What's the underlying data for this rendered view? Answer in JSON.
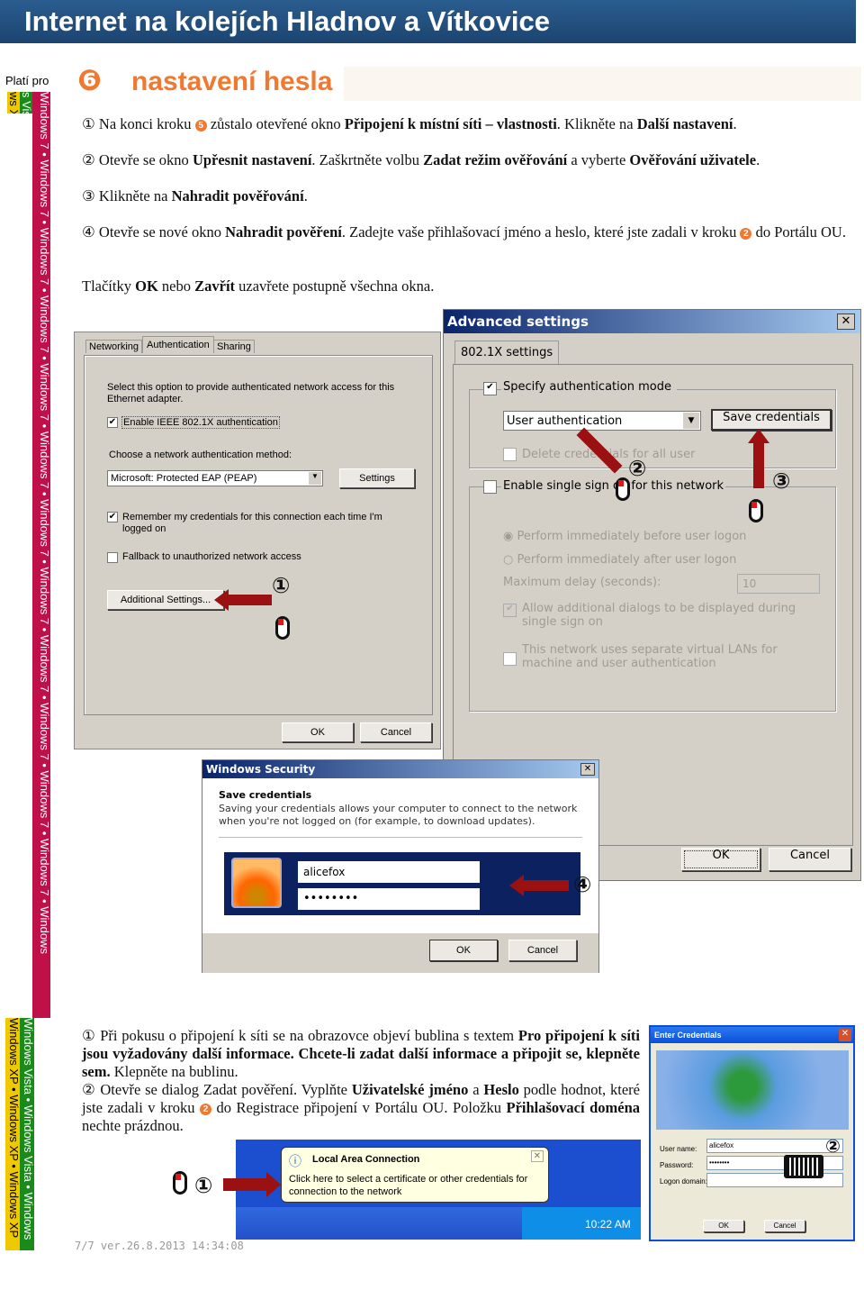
{
  "header": {
    "title": "Internet na kolejích Hladnov a Vítkovice"
  },
  "sidebar": {
    "applies_label": "Platí pro",
    "win7": "Windows 7 • Windows 7 • Windows 7 • Windows 7 • Windows 7 • Windows 7 • Windows 7 • Windows 7 • Windows 7 • Windows 7 • Windows 7 • Windows 7 • Windows",
    "vista": "Windows Vista • Windows Vista • Windows",
    "xp": "Windows XP • Windows XP • Windows XP",
    "top_yellow": "ws XP",
    "top_green": "s Vista"
  },
  "section": {
    "number": "❻",
    "title": "nastavení hesla"
  },
  "steps": [
    {
      "html": "① Na konci kroku <span class='num'>5</span> zůstalo otevřené okno <b>Připojení k místní síti – vlastnosti</b>. Klikněte na <b>Další nastavení</b>."
    },
    {
      "html": "② Otevře se okno <b>Upřesnit nastavení</b>. Zaškrtněte volbu <b>Zadat režim ověřování</b> a vyberte <b>Ověřování uživatele</b>."
    },
    {
      "html": "③ Klikněte na <b>Nahradit pověřování</b>."
    },
    {
      "html": "④ Otevře se nové okno <b>Nahradit pověření</b>. Zadejte vaše přihlašovací jméno a heslo, které jste zadali v kroku <span class='num'>2</span> do Portálu OU."
    },
    {
      "html": "Tlačítky <b>OK</b> nebo <b>Zavřít</b> uzavřete postupně všechna okna."
    }
  ],
  "properties_dialog": {
    "tabs": [
      "Networking",
      "Authentication",
      "Sharing"
    ],
    "desc": "Select this option to provide authenticated network access for this Ethernet adapter.",
    "enable_8021x": "Enable IEEE 802.1X authentication",
    "choose_method": "Choose a network authentication method:",
    "method_value": "Microsoft: Protected EAP (PEAP)",
    "settings": "Settings",
    "remember": "Remember my credentials for this connection each time I'm logged on",
    "fallback": "Fallback to unauthorized network access",
    "additional": "Additional Settings...",
    "ok": "OK",
    "cancel": "Cancel",
    "remember_checked": true,
    "enable_checked": true,
    "fallback_checked": false
  },
  "advanced_dialog": {
    "title": "Advanced settings",
    "tab": "802.1X settings",
    "specify_mode": "Specify authentication mode",
    "mode_value": "User authentication",
    "save_credentials": "Save credentials",
    "delete_credentials": "Delete credentials for all user",
    "sso": "Enable single sign on for this network",
    "before_logon": "Perform immediately before user logon",
    "after_logon": "Perform immediately after user logon",
    "max_delay": "Maximum delay (seconds):",
    "max_delay_value": "10",
    "allow_dialogs": "Allow additional dialogs to be displayed during single sign on",
    "vlans": "This network uses separate virtual LANs for machine and user authentication",
    "ok": "OK",
    "cancel": "Cancel"
  },
  "security_dialog": {
    "title": "Windows Security",
    "heading": "Save credentials",
    "desc": "Saving your credentials allows your computer to connect to the network when you're not logged on (for example, to download updates).",
    "username": "alicefox",
    "password": "••••••••",
    "ok": "OK",
    "cancel": "Cancel"
  },
  "markers": {
    "m1": "①",
    "m2": "②",
    "m3": "③",
    "m4": "④"
  },
  "xp_section": {
    "html": "① Při pokusu o připojení k síti se na obrazovce objeví bublina s textem <b>Pro připojení k síti jsou vyžadovány další informace. Chcete-li zadat další informace a připojit se, klepněte sem.</b> Klepněte na bublinu.<br>② Otevře se dialog Zadat pověření. Vyplňte <b>Uživatelské jméno</b> a <b>Heslo</b> podle hodnot, které jste zadali v kroku <span class='num'>2</span> do Registrace připojení v Portálu OU. Položku <b>Přihlašovací doména</b> nechte prázdnou.",
    "balloon_title": "Local Area Connection",
    "balloon_text": "Click here to select a certificate or other credentials for connection to the network",
    "clock": "10:22 AM"
  },
  "enter_credentials": {
    "title": "Enter Credentials",
    "user_label": "User name:",
    "user_value": "alicefox",
    "password_label": "Password:",
    "password_value": "••••••••",
    "domain_label": "Logon domain:",
    "ok": "OK",
    "cancel": "Cancel"
  },
  "footer": {
    "text": "7/7 ver.26.8.2013 14:34:08"
  },
  "colors": {
    "header": "#1f4c7a",
    "accent": "#f07830",
    "win7": "#c0104a",
    "vista": "#1a8a1a",
    "xp": "#f0c800",
    "arrow": "#9b1010"
  }
}
